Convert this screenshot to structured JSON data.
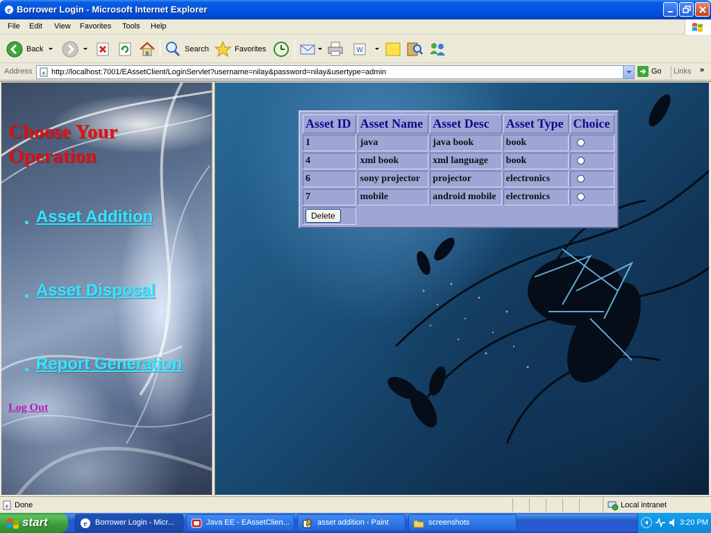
{
  "window": {
    "title": "Borrower Login - Microsoft Internet Explorer"
  },
  "menubar": {
    "items": [
      "File",
      "Edit",
      "View",
      "Favorites",
      "Tools",
      "Help"
    ]
  },
  "toolbar": {
    "back_label": "Back",
    "search_label": "Search",
    "favorites_label": "Favorites"
  },
  "addressbar": {
    "label": "Address",
    "url": "http://localhost:7001/EAssetClient/LoginServlet?username=nilay&password=nilay&usertype=admin",
    "go_label": "Go",
    "links_label": "Links"
  },
  "left_frame": {
    "heading": "Choose Your Operation",
    "nav_links": [
      "Asset Addition",
      "Asset Disposal",
      "Report Generation"
    ],
    "logout_label": "Log Out",
    "link_color": "#33e6ff",
    "heading_color": "#e01010"
  },
  "asset_table": {
    "headers": [
      "Asset ID",
      "Asset Name",
      "Asset Desc",
      "Asset Type",
      "Choice"
    ],
    "rows": [
      {
        "id": "1",
        "name": "java",
        "desc": "java book",
        "type": "book"
      },
      {
        "id": "4",
        "name": "xml book",
        "desc": "xml language",
        "type": "book"
      },
      {
        "id": "6",
        "name": "sony projector",
        "desc": "projector",
        "type": "electronics"
      },
      {
        "id": "7",
        "name": "mobile",
        "desc": "android mobile",
        "type": "electronics"
      }
    ],
    "delete_label": "Delete"
  },
  "statusbar": {
    "status": "Done",
    "zone": "Local intranet"
  },
  "taskbar": {
    "start_label": "start",
    "tasks": [
      {
        "label": "Borrower Login - Micr...",
        "icon": "ie-icon"
      },
      {
        "label": "Java EE - EAssetClien...",
        "icon": "java-ee-icon"
      },
      {
        "label": "asset addition - Paint",
        "icon": "paint-icon"
      },
      {
        "label": "screenshots",
        "icon": "folder-icon"
      }
    ],
    "clock": "3:20 PM"
  }
}
